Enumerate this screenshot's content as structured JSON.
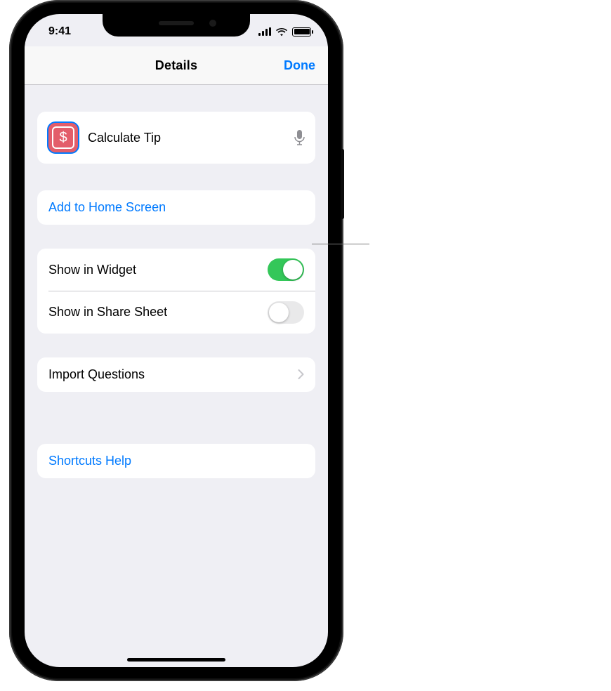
{
  "status": {
    "time": "9:41"
  },
  "nav": {
    "title": "Details",
    "done": "Done"
  },
  "header": {
    "icon_glyph": "$",
    "name": "Calculate Tip"
  },
  "actions": {
    "add_home": "Add to Home Screen",
    "help": "Shortcuts Help"
  },
  "toggles": {
    "widget_label": "Show in Widget",
    "widget_on": true,
    "share_label": "Show in Share Sheet",
    "share_on": false
  },
  "import_q": "Import Questions"
}
